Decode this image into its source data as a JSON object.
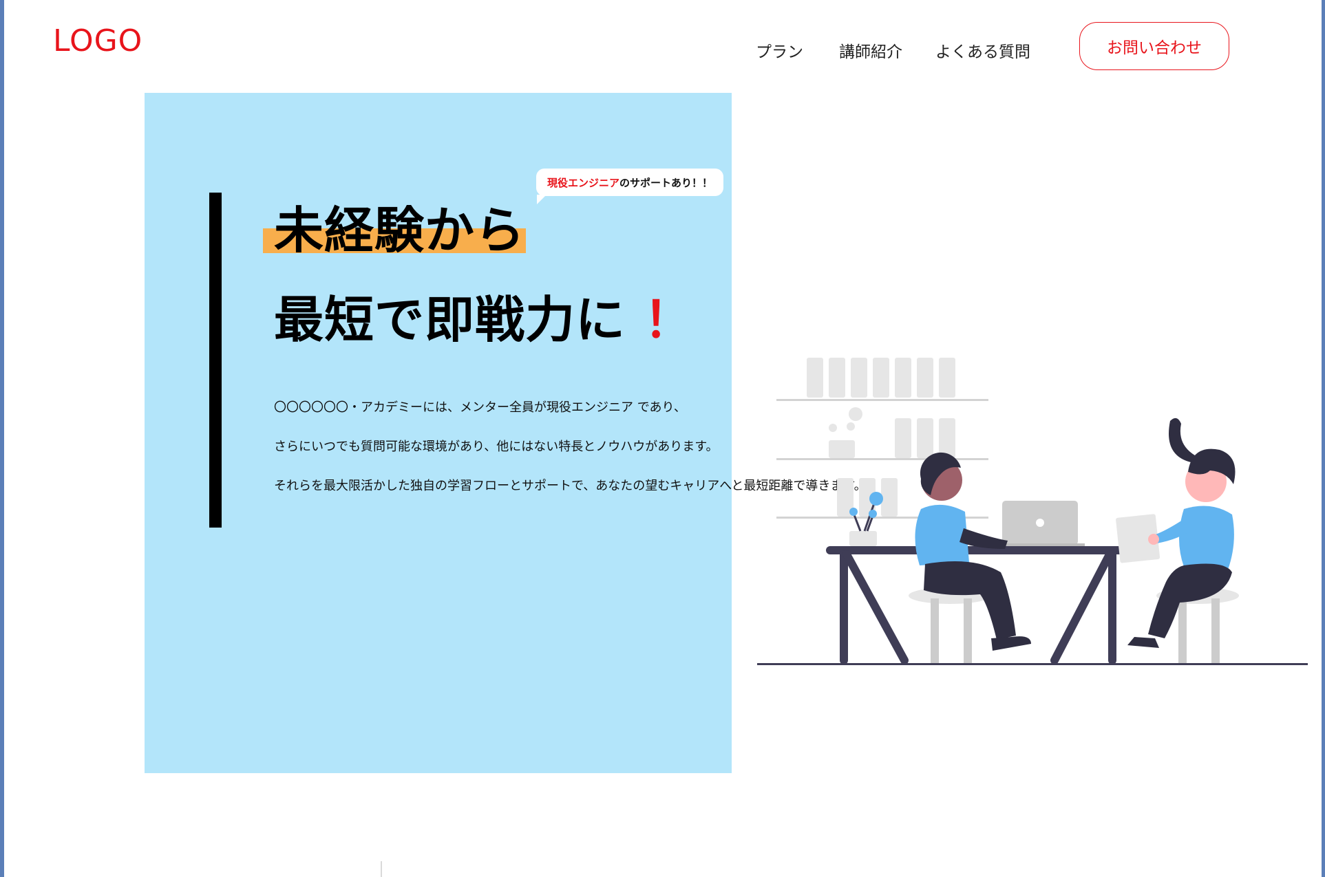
{
  "header": {
    "logo": "LOGO",
    "nav": [
      {
        "label": "プラン"
      },
      {
        "label": "講師紹介"
      },
      {
        "label": "よくある質問"
      }
    ],
    "contact_button": "お問い合わせ"
  },
  "hero": {
    "bubble_accent": "現役エンジニア",
    "bubble_rest": "のサポートあり！！",
    "headline_line1": "未経験から",
    "headline_line2": "最短で即戦力に",
    "headline_exclaim": "！",
    "body_lines": [
      "〇〇〇〇〇〇・アカデミーには、メンター全員が現役エンジニア であり、",
      "さらにいつでも質問可能な環境があり、他にはない特長とノウハウがあります。",
      "それらを最大限活かした独自の学習フローとサポートで、あなたの望むキャリアへと最短距離で導きます。"
    ]
  },
  "colors": {
    "accent": "#e8141b",
    "hero_bg": "#b3e5fa",
    "highlight": "#f8ae4c",
    "shirt": "#61b4f0"
  },
  "icons": {
    "illustration": "people-working-at-desk-illustration"
  }
}
